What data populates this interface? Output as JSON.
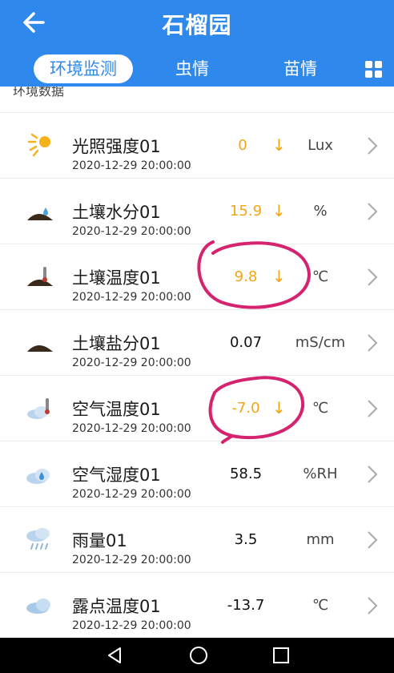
{
  "header": {
    "title": "石榴园",
    "tabs": [
      {
        "label": "环境监测",
        "active": true
      },
      {
        "label": "虫情",
        "active": false
      },
      {
        "label": "苗情",
        "active": false
      }
    ]
  },
  "section": {
    "title": "环境数据"
  },
  "rows": [
    {
      "name": "光照强度01",
      "time": "2020-12-29 20:00:00",
      "value": "0",
      "arrow": "↓",
      "unit": "Lux",
      "icon": "sun-icon"
    },
    {
      "name": "土壤水分01",
      "time": "2020-12-29 20:00:00",
      "value": "15.9",
      "arrow": "↓",
      "unit": "%",
      "icon": "soil-water-icon"
    },
    {
      "name": "土壤温度01",
      "time": "2020-12-29 20:00:00",
      "value": "9.8",
      "arrow": "↓",
      "unit": "℃",
      "icon": "soil-thermometer-icon"
    },
    {
      "name": "土壤盐分01",
      "time": "2020-12-29 20:00:00",
      "value": "0.07",
      "arrow": "",
      "unit": "mS/cm",
      "icon": "soil-mound-icon"
    },
    {
      "name": "空气温度01",
      "time": "2020-12-29 20:00:00",
      "value": "-7.0",
      "arrow": "↓",
      "unit": "℃",
      "icon": "air-thermometer-icon"
    },
    {
      "name": "空气湿度01",
      "time": "2020-12-29 20:00:00",
      "value": "58.5",
      "arrow": "",
      "unit": "%RH",
      "icon": "cloud-drop-icon"
    },
    {
      "name": "雨量01",
      "time": "2020-12-29 20:00:00",
      "value": "3.5",
      "arrow": "",
      "unit": "mm",
      "icon": "rain-cloud-icon"
    },
    {
      "name": "露点温度01",
      "time": "2020-12-29 20:00:00",
      "value": "-13.7",
      "arrow": "",
      "unit": "℃",
      "icon": "dew-cloud-icon"
    }
  ],
  "colors": {
    "header_blue": "#2f88ec",
    "warn_orange": "#f2a515",
    "annotation_pink": "#d6236f"
  },
  "navbar": {
    "icons": [
      "back-triangle-icon",
      "home-circle-icon",
      "recents-square-icon"
    ]
  }
}
